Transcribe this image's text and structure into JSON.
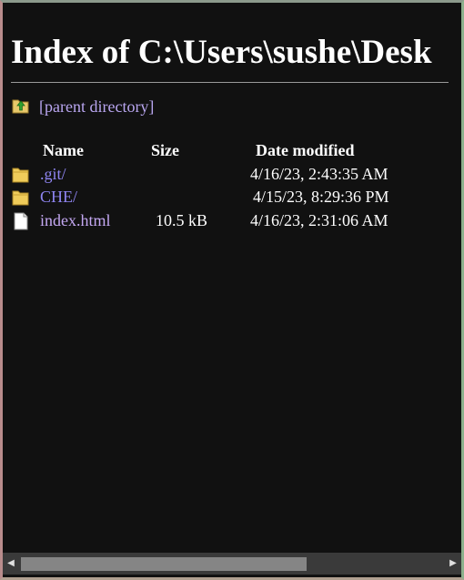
{
  "page": {
    "title": "Index of C:\\Users\\sushe\\Desk"
  },
  "parent": {
    "label": "[parent directory]",
    "icon": "folder-up-icon"
  },
  "table": {
    "headers": [
      "Name",
      "Size",
      "Date modified"
    ],
    "rows": [
      {
        "name": ".git/",
        "size": "",
        "date": "4/16/23, 2:43:35 AM",
        "icon": "folder-icon"
      },
      {
        "name": "CHE/",
        "size": "",
        "date": "4/15/23, 8:29:36 PM",
        "icon": "folder-icon"
      },
      {
        "name": "index.html",
        "size": "10.5 kB",
        "date": "4/16/23, 2:31:06 AM",
        "icon": "file-icon"
      }
    ]
  },
  "colors": {
    "background": "#111111",
    "link": "#8f85f2",
    "visited_link": "#c4a8f2",
    "text": "#ffffff"
  },
  "scrollbar": {
    "left_arrow": "◀",
    "right_arrow": "▶"
  }
}
